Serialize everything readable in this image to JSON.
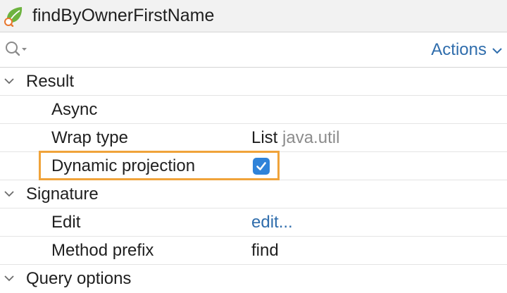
{
  "window": {
    "title": "findByOwnerFirstName",
    "icon": "spring-leaf-icon"
  },
  "toolbar": {
    "search_icon": "search-icon",
    "actions_label": "Actions"
  },
  "sections": [
    {
      "label": "Result",
      "expanded": true,
      "properties": [
        {
          "label": "Async"
        },
        {
          "label": "Wrap type",
          "value": "List",
          "value_hint": "java.util"
        },
        {
          "label": "Dynamic projection",
          "checked": true,
          "highlighted": true
        }
      ]
    },
    {
      "label": "Signature",
      "expanded": true,
      "properties": [
        {
          "label": "Edit",
          "link": "edit..."
        },
        {
          "label": "Method prefix",
          "value": "find"
        }
      ]
    },
    {
      "label": "Query options",
      "expanded": true,
      "properties": []
    }
  ],
  "colors": {
    "accent": "#2f6dac",
    "checkbox": "#2f83d9",
    "highlight": "#f0a33a"
  }
}
